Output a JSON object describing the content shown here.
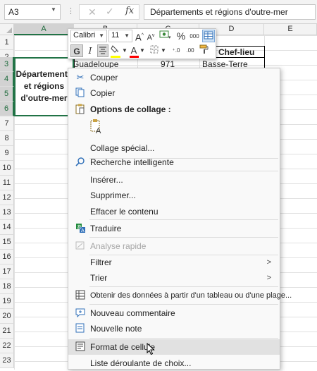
{
  "formula_bar": {
    "name_box": "A3",
    "fx_label": "fx",
    "content": "Départements et régions d'outre-mer"
  },
  "columns": [
    "A",
    "B",
    "C",
    "D",
    "E"
  ],
  "rows": [
    "1",
    "2",
    "3",
    "4",
    "5",
    "6",
    "7",
    "8",
    "9",
    "10",
    "11",
    "12",
    "13",
    "14",
    "15",
    "16",
    "17",
    "18",
    "19",
    "20",
    "21",
    "22",
    "23",
    "24",
    "25",
    "26",
    "27",
    "28",
    "29"
  ],
  "cells": {
    "a3_merged": "Départements et régions d'outre-mer",
    "d2_header": "Chef-lieu",
    "b3": "Guadeloupe",
    "c3": "971",
    "d3": "Basse-Terre"
  },
  "mini_toolbar": {
    "font_name": "Calibri",
    "font_size": "11",
    "bold_label": "G",
    "italic_label": "I",
    "percent_label": "%",
    "thousands_label": "000",
    "fill_color": "#ffff00",
    "font_color": "#ff0000"
  },
  "context_menu": {
    "cut": "Couper",
    "copy": "Copier",
    "paste_options_title": "Options de collage :",
    "paste_special": "Collage spécial...",
    "smart_lookup": "Recherche intelligente",
    "insert": "Insérer...",
    "delete": "Supprimer...",
    "clear_contents": "Effacer le contenu",
    "translate": "Traduire",
    "quick_analysis": "Analyse rapide",
    "filter": "Filtrer",
    "sort": "Trier",
    "get_data": "Obtenir des données à partir d'un tableau ou d'une plage...",
    "new_comment": "Nouveau commentaire",
    "new_note": "Nouvelle note",
    "format_cells": "Format de cellule",
    "dropdown_list": "Liste déroulante de choix..."
  },
  "colors": {
    "excel_green": "#217346",
    "menu_hover": "#e1e1e1",
    "disabled_text": "#a6a6a6"
  }
}
